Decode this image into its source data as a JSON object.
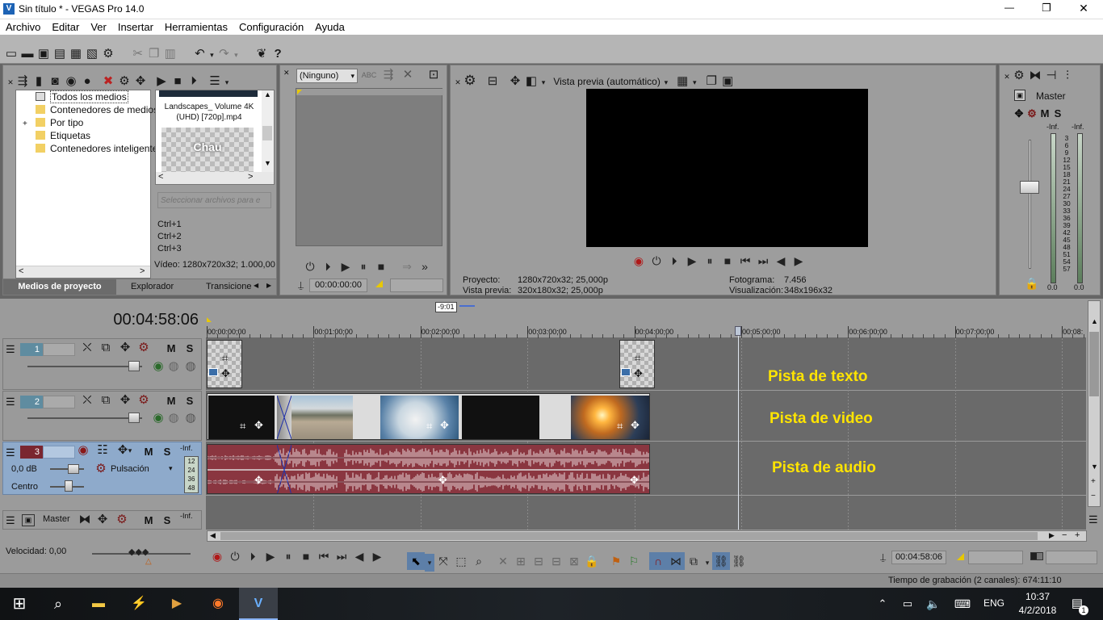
{
  "window": {
    "title": "Sin título * - VEGAS Pro 14.0",
    "minimize_glyph": "—",
    "maximize_glyph": "❐",
    "close_glyph": "✕"
  },
  "menu": [
    "Archivo",
    "Editar",
    "Ver",
    "Insertar",
    "Herramientas",
    "Configuración",
    "Ayuda"
  ],
  "media_panel": {
    "tree": [
      {
        "label": "Todos los medios",
        "selected": true
      },
      {
        "label": "Contenedores de medios"
      },
      {
        "label": "Por tipo",
        "expander": "+"
      },
      {
        "label": "Etiquetas"
      },
      {
        "label": "Contenedores inteligente"
      }
    ],
    "thumb_caption": "Landscapes_ Volume 4K (UHD) [720p].mp4",
    "thumb_text": "Chau",
    "search_placeholder": "Seleccionar archivos para e",
    "shortcuts": [
      "Ctrl+1",
      "Ctrl+2",
      "Ctrl+3"
    ],
    "video_info": "Vídeo: 1280x720x32; 1.000,00",
    "tabs": [
      "Medios de proyecto",
      "Explorador",
      "Transicione"
    ]
  },
  "trimmer": {
    "dropdown_value": "(Ninguno)",
    "timecode": "00:00:00:00"
  },
  "preview": {
    "mode_label": "Vista previa (automático)",
    "proyecto_label": "Proyecto:",
    "proyecto_value": "1280x720x32; 25,000p",
    "vista_label": "Vista previa:",
    "vista_value": "320x180x32; 25,000p",
    "fotograma_label": "Fotograma:",
    "fotograma_value": "7.456",
    "visual_label": "Visualización:",
    "visual_value": "348x196x32"
  },
  "master": {
    "label": "Master",
    "inf_left": "-Inf.",
    "inf_right": "-Inf.",
    "scale": [
      "3",
      "6",
      "9",
      "12",
      "15",
      "18",
      "21",
      "24",
      "27",
      "30",
      "33",
      "36",
      "39",
      "42",
      "45",
      "48",
      "51",
      "54",
      "57"
    ],
    "bottom_left": "0.0",
    "bottom_right": "0.0"
  },
  "timeline": {
    "cursor_time": "00:04:58:06",
    "marker_label": "-9:01",
    "ticks": [
      "00:00:00;00",
      "00:01:00;00",
      "00:02:00;00",
      "00:03:00;00",
      "00:04:00;00",
      "00:05:00;00",
      "00:06:00;00",
      "00:07:00;00",
      "00:08:"
    ],
    "tracks": [
      {
        "number": "1"
      },
      {
        "number": "2"
      },
      {
        "number": "3",
        "volume": "0,0 dB",
        "pan": "Centro",
        "fx": "Pulsación",
        "inf": "-Inf.",
        "meter": [
          "12",
          "24",
          "36",
          "48"
        ]
      }
    ],
    "master_bus_label": "Master",
    "master_bus_inf": "-Inf.",
    "annotations": [
      "Pista de texto",
      "Pista de video",
      "Pista de audio"
    ]
  },
  "transport": {
    "speed_label": "Velocidad: 0,00",
    "timecode": "00:04:58:06"
  },
  "status_bar": "Tiempo de grabación (2 canales): 674:11:10",
  "taskbar": {
    "language": "ENG",
    "time": "10:37",
    "date": "4/2/2018",
    "notification_count": "1"
  },
  "colors": {
    "audio_clip": "#8a3640",
    "annotation_yellow": "#ffe400",
    "panel_gray": "#9d9d9d"
  }
}
